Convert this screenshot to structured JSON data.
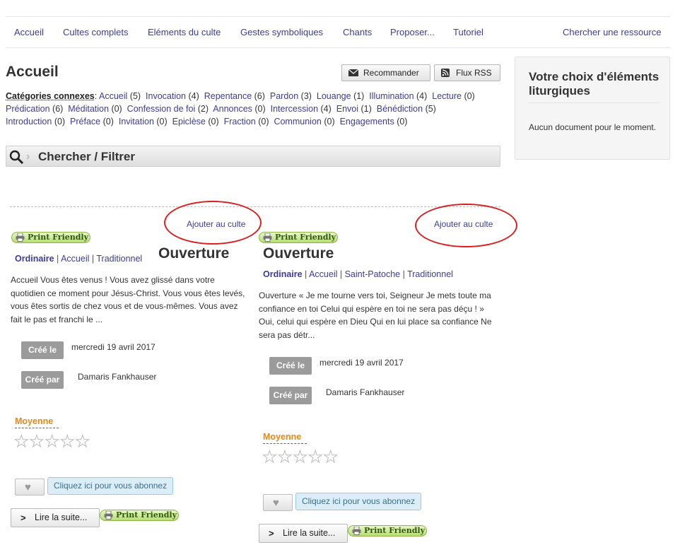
{
  "nav": {
    "items": [
      "Accueil",
      "Cultes complets",
      "Eléments du culte",
      "Gestes symboliques",
      "Chants",
      "Proposer...",
      "Tutoriel"
    ],
    "search_resource": "Chercher une ressource"
  },
  "page": {
    "title": "Accueil",
    "recommend_label": "Recommander",
    "rss_label": "Flux RSS"
  },
  "categories": {
    "heading": "Catégories connexes",
    "items": [
      {
        "name": "Accueil",
        "count": "(5)"
      },
      {
        "name": "Invocation",
        "count": "(4)"
      },
      {
        "name": "Repentance",
        "count": "(6)"
      },
      {
        "name": "Pardon",
        "count": "(3)"
      },
      {
        "name": "Louange",
        "count": "(1)"
      },
      {
        "name": "Illumination",
        "count": "(4)"
      },
      {
        "name": "Lecture",
        "count": "(0)"
      },
      {
        "name": "Prédication",
        "count": "(6)"
      },
      {
        "name": "Méditation",
        "count": "(0)"
      },
      {
        "name": "Confession de foi",
        "count": "(2)"
      },
      {
        "name": "Annonces",
        "count": "(0)"
      },
      {
        "name": "Intercession",
        "count": "(4)"
      },
      {
        "name": "Envoi",
        "count": "(1)"
      },
      {
        "name": "Bénédiction",
        "count": "(5)"
      },
      {
        "name": "Introduction",
        "count": "(0)"
      },
      {
        "name": "Préface",
        "count": "(0)"
      },
      {
        "name": "Invitation",
        "count": "(0)"
      },
      {
        "name": "Epiclèse",
        "count": "(0)"
      },
      {
        "name": "Fraction",
        "count": "(0)"
      },
      {
        "name": "Communion",
        "count": "(0)"
      },
      {
        "name": "Engagements",
        "count": "(0)"
      }
    ]
  },
  "search": {
    "label": "Chercher / Filtrer"
  },
  "sidebar": {
    "title": "Votre choix d'éléments liturgiques",
    "empty_text": "Aucun document pour le moment."
  },
  "cards": [
    {
      "add_label": "Ajouter au culte",
      "print_label": "Print Friendly",
      "title": "Ouverture",
      "tags": [
        "Ordinaire",
        "Accueil",
        "Traditionnel"
      ],
      "excerpt": "Accueil Vous êtes venus ! Vous avez glissé dans votre quotidien ce moment pour Jésus-Christ. Vous vous êtes levés, vous êtes sortis de chez vous et de vous-mêmes. Vous avez fait le pas et franchi le ...",
      "created_label": "Créé le",
      "created_value": "mercredi 19 avril 2017",
      "author_label": "Créé par",
      "author_value": "Damaris Fankhauser",
      "rating_label": "Moyenne",
      "rating": 0,
      "subscribe_label": "Cliquez ici pour vous abonnez",
      "read_more_label": "Lire la suite...",
      "print_label_bottom": "Print Friendly"
    },
    {
      "add_label": "Ajouter au culte",
      "print_label": "Print Friendly",
      "title": "Ouverture",
      "tags": [
        "Ordinaire",
        "Accueil",
        "Saint-Patoche",
        "Traditionnel"
      ],
      "excerpt": "Ouverture « Je me tourne vers toi, Seigneur Je mets toute ma confiance en toi Celui qui espère en toi ne sera pas déçu ! » Oui, celui qui espère en Dieu Qui en lui place sa confiance Ne sera pas détr...",
      "created_label": "Créé le",
      "created_value": "mercredi 19 avril 2017",
      "author_label": "Créé par",
      "author_value": "Damaris Fankhauser",
      "rating_label": "Moyenne",
      "rating": 0,
      "subscribe_label": "Cliquez ici pour vous abonnez",
      "read_more_label": "Lire la suite...",
      "print_label_bottom": "Print Friendly"
    }
  ],
  "colors": {
    "link": "#3c3c9c",
    "annotation_circle": "#d82020",
    "rating_label": "#e08a1a",
    "meta_label_bg": "#9b9b9b"
  }
}
